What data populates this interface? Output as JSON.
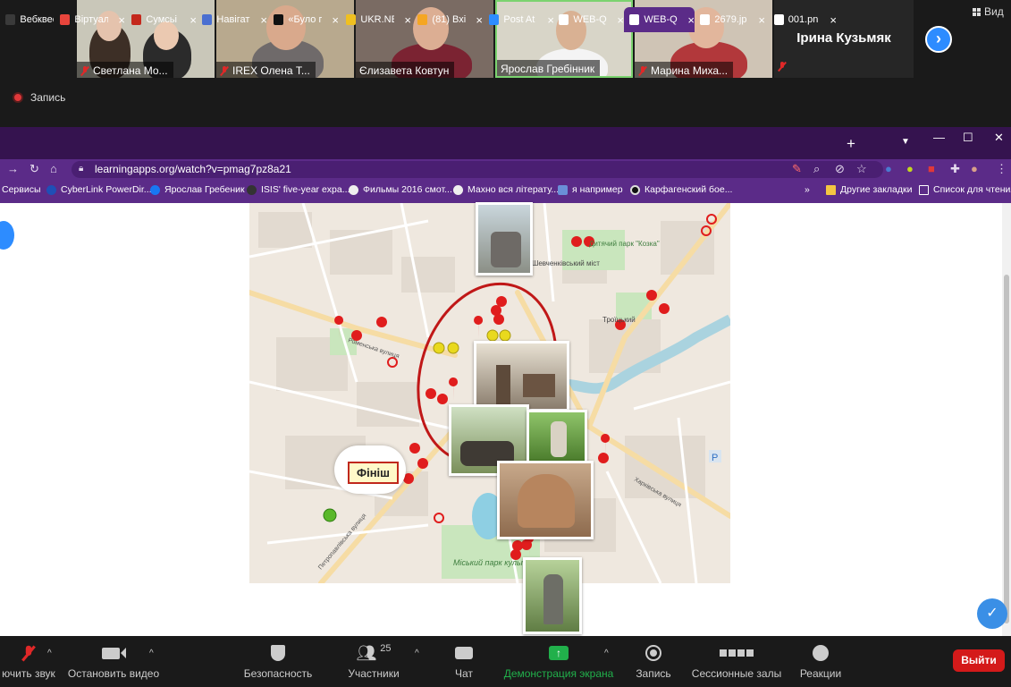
{
  "zoom": {
    "participants_strip": [
      {
        "name": "Светлана Мо..."
      },
      {
        "name": "IREX Олена Т..."
      },
      {
        "name": "Єлизавета Ковтун"
      },
      {
        "name": "Ярослав Гребінник"
      },
      {
        "name": "Марина Миха..."
      }
    ],
    "active_speaker": "Ірина Кузьмяк",
    "view_label": "Вид",
    "recording_label": "Запись",
    "toolbar": {
      "mute": "ючить звук",
      "video": "Остановить видео",
      "security": "Безопасность",
      "participants": "Участники",
      "participants_count": "25",
      "chat": "Чат",
      "share": "Демонстрация экрана",
      "record": "Запись",
      "breakout": "Сессионные залы",
      "reactions": "Реакции",
      "leave": "Выйти"
    }
  },
  "browser": {
    "tabs": [
      {
        "title": "Вебквес",
        "color": "#3a3a3a"
      },
      {
        "title": "Віртуал",
        "color": "#e8453c"
      },
      {
        "title": "Сумсьі",
        "color": "#c4281c"
      },
      {
        "title": "Навігат",
        "color": "#4a6fd1"
      },
      {
        "title": "«Було г",
        "color": "#111111"
      },
      {
        "title": "UKR.NE",
        "color": "#f0c020"
      },
      {
        "title": "(81) Вхі",
        "color": "#f5a623"
      },
      {
        "title": "Post At",
        "color": "#2d8cff"
      },
      {
        "title": "WEB-Q",
        "color": "#ffffff"
      },
      {
        "title": "WEB-Q",
        "color": "#ffffff"
      },
      {
        "title": "2679.jp",
        "color": "#ffffff"
      },
      {
        "title": "001.pn",
        "color": "#ffffff"
      }
    ],
    "url": "learningapps.org/watch?v=pmag7pz8a21",
    "bookmarks": [
      "Сервисы",
      "CyberLink PowerDir...",
      "Ярослав Гребеник",
      "ISIS' five-year expa...",
      "Фильмы 2016 смот...",
      "Махно вся літерату...",
      "я например",
      "Карфагенский бое..."
    ],
    "bookmarks_overflow": "»",
    "other_bookmarks": "Другие закладки",
    "reading_list": "Список для чтения"
  },
  "map": {
    "labels": {
      "finish": "Фініш",
      "park_kozka": "Дитячий парк \"Козка\"",
      "bridge": "Шевченківський міст",
      "trinity": "Троїцький",
      "city_park": "Міський парк культури",
      "street_romenska": "Роменська вулиця",
      "street_kharkivska": "Харківська вулиця",
      "street_petropavlivska": "Петропавлівська вулиця",
      "parking": "P"
    }
  },
  "colors": {
    "zoom_bg": "#1a1a1a",
    "chrome_tabstrip": "#35134f",
    "chrome_toolbar": "#5b2b88",
    "zoom_blue": "#2d8cff",
    "leave_red": "#d41a1a",
    "share_green": "#21b04b"
  }
}
